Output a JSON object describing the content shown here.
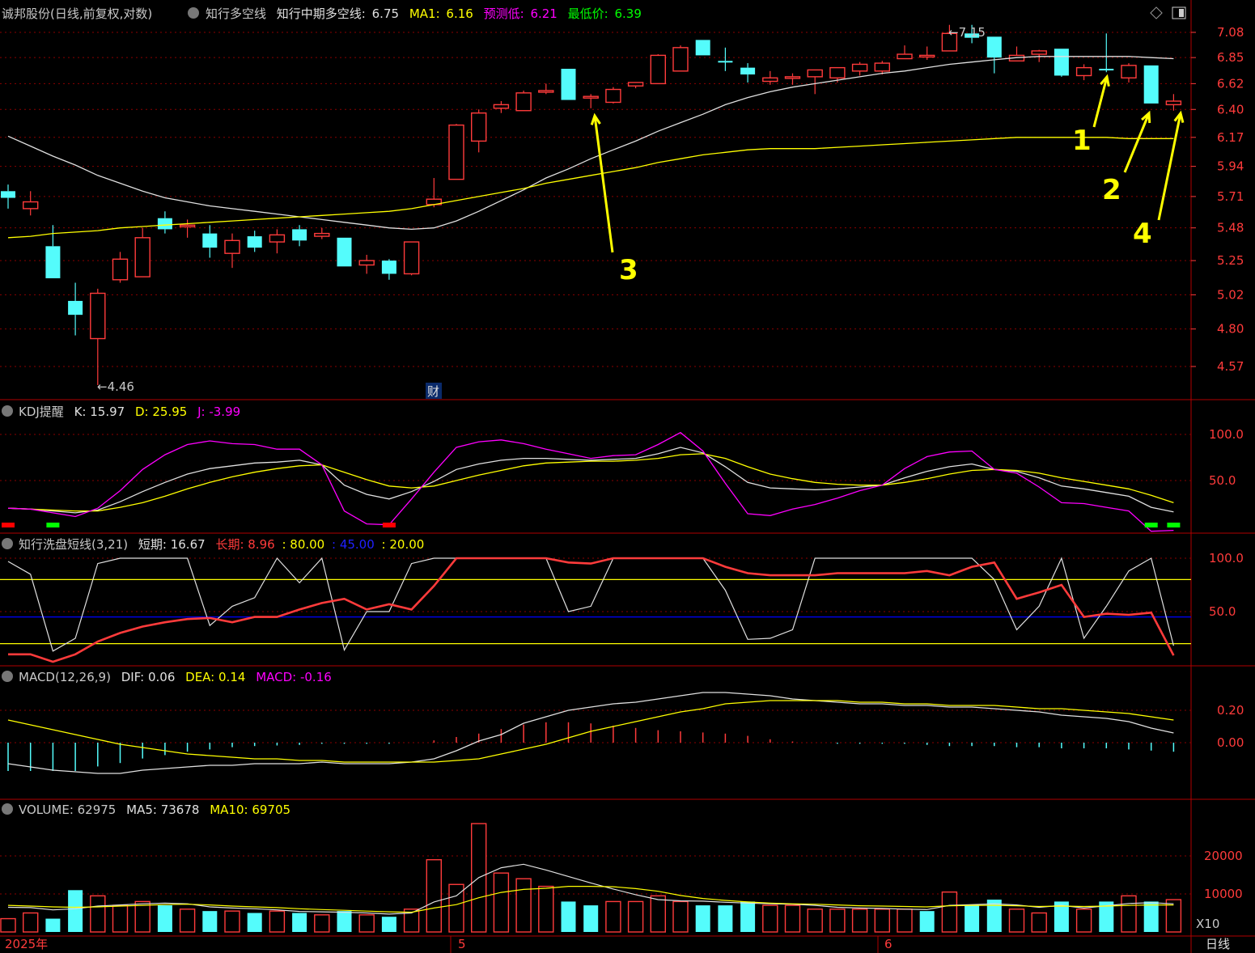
{
  "header": {
    "stock": "诚邦股份(日线,前复权,对数)",
    "indicator": "知行多空线",
    "mid_label": "知行中期多空线:",
    "mid_value": "6.75",
    "ma1_label": "MA1:",
    "ma1_value": "6.16",
    "pred_label": "预测低:",
    "pred_value": "6.21",
    "low_label": "最低价:",
    "low_value": "6.39"
  },
  "kdj": {
    "name": "KDJ提醒",
    "k": "K: 15.97",
    "d": "D: 25.95",
    "j": "J: -3.99"
  },
  "wash": {
    "name": "知行洗盘短线(3,21)",
    "short": "短期: 16.67",
    "long": "长期: 8.96",
    "l1": ": 80.00",
    "l2": ": 45.00",
    "l3": ": 20.00"
  },
  "macd": {
    "name": "MACD(12,26,9)",
    "dif": "DIF: 0.06",
    "dea": "DEA: 0.14",
    "macd": "MACD: -0.16"
  },
  "volume": {
    "name": "VOLUME: 62975",
    "ma5": "MA5: 73678",
    "ma10": "MA10: 69705",
    "mult": "X10"
  },
  "footer": {
    "year": "2025年",
    "m5": "5",
    "m6": "6",
    "period": "日线"
  },
  "annotations": {
    "low_mark": "←4.46",
    "high_mark": "←7.15",
    "cai": "财",
    "n1": "1",
    "n2": "2",
    "n3": "3",
    "n4": "4"
  },
  "colors": {
    "up": "#ff3b3b",
    "down": "#54fcfc",
    "ma_white": "#e0e0e0",
    "ma_yellow": "#ffff00",
    "kdj_j": "#ff00ff",
    "blue_line": "#0000ff",
    "grid": "#8b0000"
  },
  "chart_data": [
    {
      "type": "candlestick",
      "title": "诚邦股份(日线,前复权,对数)",
      "y_scale": "log",
      "y_ticks": [
        7.08,
        6.85,
        6.62,
        6.4,
        6.17,
        5.94,
        5.71,
        5.48,
        5.25,
        5.02,
        4.8,
        4.57
      ],
      "ohlc": [
        [
          5.75,
          5.8,
          5.62,
          5.7
        ],
        [
          5.62,
          5.75,
          5.57,
          5.67
        ],
        [
          5.35,
          5.5,
          5.13,
          5.13
        ],
        [
          4.98,
          5.1,
          4.76,
          4.89
        ],
        [
          4.74,
          5.06,
          4.46,
          5.03
        ],
        [
          5.12,
          5.31,
          5.1,
          5.26
        ],
        [
          5.14,
          5.48,
          5.14,
          5.41
        ],
        [
          5.55,
          5.6,
          5.44,
          5.47
        ],
        [
          5.49,
          5.54,
          5.41,
          5.5
        ],
        [
          5.44,
          5.5,
          5.27,
          5.34
        ],
        [
          5.3,
          5.44,
          5.2,
          5.39
        ],
        [
          5.42,
          5.46,
          5.31,
          5.34
        ],
        [
          5.38,
          5.47,
          5.3,
          5.43
        ],
        [
          5.47,
          5.5,
          5.35,
          5.39
        ],
        [
          5.42,
          5.48,
          5.4,
          5.44
        ],
        [
          5.41,
          5.41,
          5.21,
          5.21
        ],
        [
          5.22,
          5.29,
          5.16,
          5.25
        ],
        [
          5.25,
          5.26,
          5.12,
          5.16
        ],
        [
          5.16,
          5.33,
          5.15,
          5.38
        ],
        [
          5.65,
          5.85,
          5.63,
          5.69
        ],
        [
          5.84,
          6.28,
          5.84,
          6.27
        ],
        [
          6.14,
          6.4,
          6.05,
          6.37
        ],
        [
          6.41,
          6.47,
          6.37,
          6.44
        ],
        [
          6.39,
          6.56,
          6.39,
          6.54
        ],
        [
          6.55,
          6.62,
          6.53,
          6.56
        ],
        [
          6.75,
          6.75,
          6.48,
          6.48
        ],
        [
          6.5,
          6.53,
          6.41,
          6.51
        ],
        [
          6.46,
          6.59,
          6.45,
          6.57
        ],
        [
          6.6,
          6.63,
          6.58,
          6.63
        ],
        [
          6.62,
          6.88,
          6.62,
          6.87
        ],
        [
          6.73,
          6.96,
          6.73,
          6.94
        ],
        [
          7.01,
          7.01,
          6.87,
          6.87
        ],
        [
          6.82,
          6.94,
          6.73,
          6.81
        ],
        [
          6.76,
          6.8,
          6.63,
          6.7
        ],
        [
          6.64,
          6.73,
          6.61,
          6.67
        ],
        [
          6.68,
          6.71,
          6.61,
          6.68
        ],
        [
          6.68,
          6.74,
          6.53,
          6.74
        ],
        [
          6.67,
          6.76,
          6.63,
          6.76
        ],
        [
          6.73,
          6.81,
          6.69,
          6.79
        ],
        [
          6.73,
          6.82,
          6.7,
          6.8
        ],
        [
          6.84,
          6.96,
          6.84,
          6.88
        ],
        [
          6.86,
          6.95,
          6.83,
          6.87
        ],
        [
          6.91,
          7.15,
          6.91,
          7.07
        ],
        [
          7.07,
          7.15,
          6.98,
          7.03
        ],
        [
          7.04,
          7.04,
          6.71,
          6.85
        ],
        [
          6.82,
          6.95,
          6.82,
          6.87
        ],
        [
          6.88,
          6.92,
          6.81,
          6.91
        ],
        [
          6.93,
          6.93,
          6.68,
          6.69
        ],
        [
          6.69,
          6.79,
          6.65,
          6.76
        ],
        [
          6.75,
          7.07,
          6.72,
          6.74
        ],
        [
          6.67,
          6.8,
          6.63,
          6.78
        ],
        [
          6.78,
          6.78,
          6.45,
          6.45
        ],
        [
          6.44,
          6.53,
          6.39,
          6.47
        ]
      ],
      "ma_white": [
        6.18,
        6.1,
        6.02,
        5.95,
        5.87,
        5.81,
        5.75,
        5.7,
        5.67,
        5.64,
        5.62,
        5.6,
        5.58,
        5.56,
        5.54,
        5.52,
        5.5,
        5.48,
        5.47,
        5.48,
        5.53,
        5.6,
        5.68,
        5.76,
        5.85,
        5.92,
        6.0,
        6.07,
        6.14,
        6.22,
        6.29,
        6.36,
        6.44,
        6.5,
        6.55,
        6.59,
        6.62,
        6.65,
        6.68,
        6.71,
        6.73,
        6.76,
        6.79,
        6.81,
        6.83,
        6.85,
        6.86,
        6.86,
        6.86,
        6.86,
        6.86,
        6.85,
        6.84
      ],
      "ma_yellow": [
        5.41,
        5.42,
        5.44,
        5.45,
        5.46,
        5.48,
        5.49,
        5.5,
        5.51,
        5.52,
        5.53,
        5.54,
        5.55,
        5.56,
        5.57,
        5.58,
        5.59,
        5.6,
        5.62,
        5.65,
        5.68,
        5.71,
        5.74,
        5.77,
        5.81,
        5.84,
        5.87,
        5.9,
        5.93,
        5.97,
        6.0,
        6.03,
        6.05,
        6.07,
        6.08,
        6.08,
        6.08,
        6.09,
        6.1,
        6.11,
        6.12,
        6.13,
        6.14,
        6.15,
        6.16,
        6.17,
        6.17,
        6.17,
        6.17,
        6.17,
        6.16,
        6.16,
        6.16
      ]
    },
    {
      "type": "line",
      "title": "KDJ提醒",
      "y_ticks": [
        100.0,
        50.0
      ],
      "series": [
        {
          "name": "K",
          "values": [
            20,
            19,
            17,
            15,
            18,
            27,
            38,
            48,
            57,
            63,
            66,
            69,
            70,
            72,
            67,
            45,
            35,
            30,
            38,
            49,
            62,
            68,
            72,
            74,
            74,
            73,
            72,
            73,
            74,
            79,
            86,
            80,
            65,
            48,
            42,
            41,
            40,
            41,
            43,
            45,
            53,
            60,
            65,
            68,
            62,
            60,
            53,
            44,
            41,
            37,
            33,
            21,
            16
          ]
        },
        {
          "name": "D",
          "values": [
            20,
            19,
            18,
            17,
            17,
            21,
            26,
            33,
            41,
            48,
            54,
            59,
            63,
            66,
            67,
            59,
            51,
            44,
            42,
            44,
            50,
            56,
            61,
            66,
            69,
            70,
            71,
            71,
            72,
            74,
            78,
            79,
            74,
            65,
            57,
            52,
            48,
            46,
            45,
            45,
            48,
            52,
            57,
            61,
            62,
            61,
            58,
            53,
            49,
            45,
            41,
            34,
            26
          ]
        },
        {
          "name": "J",
          "values": [
            20,
            19,
            15,
            11,
            20,
            39,
            62,
            78,
            89,
            93,
            90,
            89,
            84,
            84,
            67,
            17,
            3,
            2,
            30,
            59,
            86,
            92,
            94,
            90,
            84,
            79,
            74,
            77,
            78,
            89,
            102,
            82,
            47,
            14,
            12,
            19,
            24,
            31,
            39,
            45,
            63,
            76,
            81,
            82,
            62,
            58,
            43,
            26,
            25,
            21,
            17,
            -5,
            -4
          ]
        }
      ]
    },
    {
      "type": "line",
      "title": "知行洗盘短线(3,21)",
      "y_ticks": [
        100.0,
        50.0
      ],
      "reference_lines": [
        80,
        45,
        20
      ],
      "series": [
        {
          "name": "短期",
          "values": [
            97,
            85,
            13,
            25,
            95,
            100,
            100,
            100,
            100,
            37,
            55,
            63,
            100,
            77,
            100,
            14,
            50,
            50,
            95,
            100,
            100,
            100,
            100,
            100,
            100,
            50,
            55,
            100,
            100,
            100,
            100,
            100,
            70,
            24,
            25,
            33,
            100,
            100,
            100,
            100,
            100,
            100,
            100,
            100,
            80,
            33,
            55,
            100,
            25,
            55,
            88,
            100,
            18
          ]
        },
        {
          "name": "长期",
          "values": [
            10,
            10,
            3,
            10,
            22,
            30,
            36,
            40,
            43,
            44,
            40,
            45,
            45,
            52,
            58,
            62,
            52,
            57,
            52,
            74,
            100,
            100,
            100,
            100,
            100,
            96,
            95,
            100,
            100,
            100,
            100,
            100,
            92,
            86,
            84,
            84,
            84,
            86,
            86,
            86,
            86,
            88,
            84,
            92,
            96,
            62,
            68,
            75,
            45,
            48,
            47,
            49,
            9
          ]
        }
      ]
    },
    {
      "type": "bar",
      "title": "MACD(12,26,9)",
      "y_ticks": [
        0.2,
        0.0
      ],
      "series": [
        {
          "name": "DIF",
          "values": [
            -0.13,
            -0.15,
            -0.17,
            -0.18,
            -0.19,
            -0.19,
            -0.17,
            -0.16,
            -0.15,
            -0.14,
            -0.14,
            -0.13,
            -0.13,
            -0.13,
            -0.12,
            -0.13,
            -0.13,
            -0.13,
            -0.12,
            -0.1,
            -0.05,
            0.01,
            0.05,
            0.12,
            0.16,
            0.2,
            0.22,
            0.24,
            0.25,
            0.27,
            0.29,
            0.31,
            0.31,
            0.3,
            0.29,
            0.27,
            0.26,
            0.25,
            0.24,
            0.24,
            0.23,
            0.23,
            0.22,
            0.22,
            0.21,
            0.2,
            0.19,
            0.17,
            0.16,
            0.15,
            0.13,
            0.09,
            0.06
          ]
        },
        {
          "name": "DEA",
          "values": [
            0.14,
            0.11,
            0.08,
            0.05,
            0.02,
            -0.01,
            -0.03,
            -0.05,
            -0.07,
            -0.08,
            -0.09,
            -0.1,
            -0.1,
            -0.11,
            -0.11,
            -0.12,
            -0.12,
            -0.12,
            -0.12,
            -0.12,
            -0.11,
            -0.1,
            -0.07,
            -0.04,
            -0.01,
            0.03,
            0.07,
            0.1,
            0.13,
            0.16,
            0.19,
            0.21,
            0.24,
            0.25,
            0.26,
            0.26,
            0.26,
            0.26,
            0.25,
            0.25,
            0.24,
            0.24,
            0.23,
            0.23,
            0.23,
            0.22,
            0.21,
            0.21,
            0.2,
            0.19,
            0.18,
            0.16,
            0.14
          ]
        },
        {
          "name": "MACD",
          "values": [
            -0.5,
            -0.5,
            -0.5,
            -0.5,
            -0.42,
            -0.36,
            -0.28,
            -0.22,
            -0.16,
            -0.12,
            -0.08,
            -0.06,
            -0.05,
            -0.04,
            -0.02,
            -0.02,
            -0.02,
            -0.02,
            0.0,
            0.04,
            0.1,
            0.16,
            0.24,
            0.32,
            0.36,
            0.36,
            0.34,
            0.3,
            0.26,
            0.22,
            0.2,
            0.18,
            0.16,
            0.12,
            0.06,
            0.02,
            0.0,
            -0.02,
            -0.02,
            -0.02,
            -0.02,
            -0.04,
            -0.06,
            -0.06,
            -0.06,
            -0.08,
            -0.08,
            -0.1,
            -0.1,
            -0.1,
            -0.12,
            -0.14,
            -0.16
          ]
        }
      ]
    },
    {
      "type": "bar",
      "title": "VOLUME",
      "y_ticks": [
        20000,
        10000
      ],
      "values": [
        3500,
        5000,
        3500,
        11000,
        9500,
        7000,
        8000,
        7000,
        6000,
        5500,
        5500,
        5000,
        5500,
        5000,
        4500,
        5500,
        4500,
        4000,
        6000,
        19000,
        12500,
        28500,
        15500,
        14000,
        12000,
        8000,
        7000,
        8000,
        8000,
        9500,
        8000,
        7000,
        7000,
        8000,
        7000,
        7000,
        6000,
        6000,
        6000,
        6000,
        6000,
        5500,
        10500,
        7000,
        8500,
        6000,
        5000,
        8000,
        6000,
        8000,
        9500,
        8000,
        8500
      ],
      "up_days": [
        1,
        1,
        0,
        0,
        1,
        1,
        1,
        0,
        1,
        0,
        1,
        0,
        1,
        0,
        1,
        0,
        1,
        0,
        1,
        1,
        1,
        1,
        1,
        1,
        1,
        0,
        0,
        1,
        1,
        1,
        1,
        0,
        0,
        0,
        1,
        1,
        1,
        1,
        1,
        1,
        1,
        0,
        1,
        0,
        0,
        1,
        1,
        0,
        1,
        0,
        1,
        0,
        1
      ],
      "ma_white": [
        6500,
        6400,
        5800,
        6100,
        6800,
        7100,
        7400,
        7600,
        7400,
        6600,
        6300,
        6100,
        5800,
        5400,
        5300,
        5200,
        5000,
        4700,
        5000,
        7900,
        9500,
        14300,
        16900,
        17800,
        16300,
        14600,
        12900,
        11300,
        9800,
        8500,
        8200,
        8100,
        7800,
        7600,
        7400,
        7300,
        7000,
        6500,
        6300,
        6200,
        6000,
        5900,
        7000,
        7200,
        7400,
        7100,
        6500,
        7000,
        6300,
        6900,
        7500,
        7700,
        7400
      ],
      "ma_yellow": [
        7000,
        6800,
        6600,
        6500,
        6600,
        6800,
        7000,
        7200,
        7300,
        7100,
        6800,
        6600,
        6400,
        6100,
        5900,
        5700,
        5500,
        5300,
        5200,
        6300,
        7200,
        9000,
        10400,
        11200,
        11500,
        12000,
        12000,
        11900,
        11400,
        10700,
        9600,
        8800,
        8300,
        7900,
        7600,
        7400,
        7300,
        7100,
        6900,
        6800,
        6700,
        6600,
        6900,
        7000,
        7000,
        6900,
        6700,
        6800,
        6700,
        6800,
        7000,
        7100,
        7100
      ]
    }
  ]
}
